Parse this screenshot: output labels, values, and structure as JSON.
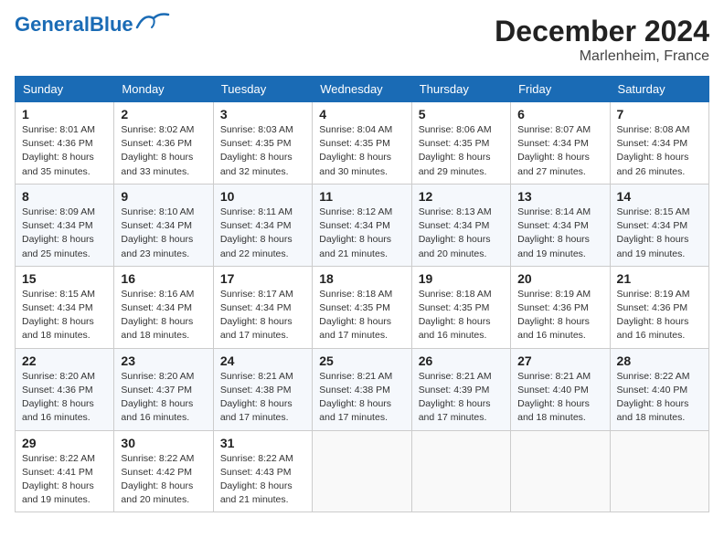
{
  "header": {
    "logo_general": "General",
    "logo_blue": "Blue",
    "month": "December 2024",
    "location": "Marlenheim, France"
  },
  "weekdays": [
    "Sunday",
    "Monday",
    "Tuesday",
    "Wednesday",
    "Thursday",
    "Friday",
    "Saturday"
  ],
  "weeks": [
    [
      {
        "day": "1",
        "sunrise": "8:01 AM",
        "sunset": "4:36 PM",
        "daylight": "8 hours and 35 minutes."
      },
      {
        "day": "2",
        "sunrise": "8:02 AM",
        "sunset": "4:36 PM",
        "daylight": "8 hours and 33 minutes."
      },
      {
        "day": "3",
        "sunrise": "8:03 AM",
        "sunset": "4:35 PM",
        "daylight": "8 hours and 32 minutes."
      },
      {
        "day": "4",
        "sunrise": "8:04 AM",
        "sunset": "4:35 PM",
        "daylight": "8 hours and 30 minutes."
      },
      {
        "day": "5",
        "sunrise": "8:06 AM",
        "sunset": "4:35 PM",
        "daylight": "8 hours and 29 minutes."
      },
      {
        "day": "6",
        "sunrise": "8:07 AM",
        "sunset": "4:34 PM",
        "daylight": "8 hours and 27 minutes."
      },
      {
        "day": "7",
        "sunrise": "8:08 AM",
        "sunset": "4:34 PM",
        "daylight": "8 hours and 26 minutes."
      }
    ],
    [
      {
        "day": "8",
        "sunrise": "8:09 AM",
        "sunset": "4:34 PM",
        "daylight": "8 hours and 25 minutes."
      },
      {
        "day": "9",
        "sunrise": "8:10 AM",
        "sunset": "4:34 PM",
        "daylight": "8 hours and 23 minutes."
      },
      {
        "day": "10",
        "sunrise": "8:11 AM",
        "sunset": "4:34 PM",
        "daylight": "8 hours and 22 minutes."
      },
      {
        "day": "11",
        "sunrise": "8:12 AM",
        "sunset": "4:34 PM",
        "daylight": "8 hours and 21 minutes."
      },
      {
        "day": "12",
        "sunrise": "8:13 AM",
        "sunset": "4:34 PM",
        "daylight": "8 hours and 20 minutes."
      },
      {
        "day": "13",
        "sunrise": "8:14 AM",
        "sunset": "4:34 PM",
        "daylight": "8 hours and 19 minutes."
      },
      {
        "day": "14",
        "sunrise": "8:15 AM",
        "sunset": "4:34 PM",
        "daylight": "8 hours and 19 minutes."
      }
    ],
    [
      {
        "day": "15",
        "sunrise": "8:15 AM",
        "sunset": "4:34 PM",
        "daylight": "8 hours and 18 minutes."
      },
      {
        "day": "16",
        "sunrise": "8:16 AM",
        "sunset": "4:34 PM",
        "daylight": "8 hours and 18 minutes."
      },
      {
        "day": "17",
        "sunrise": "8:17 AM",
        "sunset": "4:34 PM",
        "daylight": "8 hours and 17 minutes."
      },
      {
        "day": "18",
        "sunrise": "8:18 AM",
        "sunset": "4:35 PM",
        "daylight": "8 hours and 17 minutes."
      },
      {
        "day": "19",
        "sunrise": "8:18 AM",
        "sunset": "4:35 PM",
        "daylight": "8 hours and 16 minutes."
      },
      {
        "day": "20",
        "sunrise": "8:19 AM",
        "sunset": "4:36 PM",
        "daylight": "8 hours and 16 minutes."
      },
      {
        "day": "21",
        "sunrise": "8:19 AM",
        "sunset": "4:36 PM",
        "daylight": "8 hours and 16 minutes."
      }
    ],
    [
      {
        "day": "22",
        "sunrise": "8:20 AM",
        "sunset": "4:36 PM",
        "daylight": "8 hours and 16 minutes."
      },
      {
        "day": "23",
        "sunrise": "8:20 AM",
        "sunset": "4:37 PM",
        "daylight": "8 hours and 16 minutes."
      },
      {
        "day": "24",
        "sunrise": "8:21 AM",
        "sunset": "4:38 PM",
        "daylight": "8 hours and 17 minutes."
      },
      {
        "day": "25",
        "sunrise": "8:21 AM",
        "sunset": "4:38 PM",
        "daylight": "8 hours and 17 minutes."
      },
      {
        "day": "26",
        "sunrise": "8:21 AM",
        "sunset": "4:39 PM",
        "daylight": "8 hours and 17 minutes."
      },
      {
        "day": "27",
        "sunrise": "8:21 AM",
        "sunset": "4:40 PM",
        "daylight": "8 hours and 18 minutes."
      },
      {
        "day": "28",
        "sunrise": "8:22 AM",
        "sunset": "4:40 PM",
        "daylight": "8 hours and 18 minutes."
      }
    ],
    [
      {
        "day": "29",
        "sunrise": "8:22 AM",
        "sunset": "4:41 PM",
        "daylight": "8 hours and 19 minutes."
      },
      {
        "day": "30",
        "sunrise": "8:22 AM",
        "sunset": "4:42 PM",
        "daylight": "8 hours and 20 minutes."
      },
      {
        "day": "31",
        "sunrise": "8:22 AM",
        "sunset": "4:43 PM",
        "daylight": "8 hours and 21 minutes."
      },
      null,
      null,
      null,
      null
    ]
  ]
}
